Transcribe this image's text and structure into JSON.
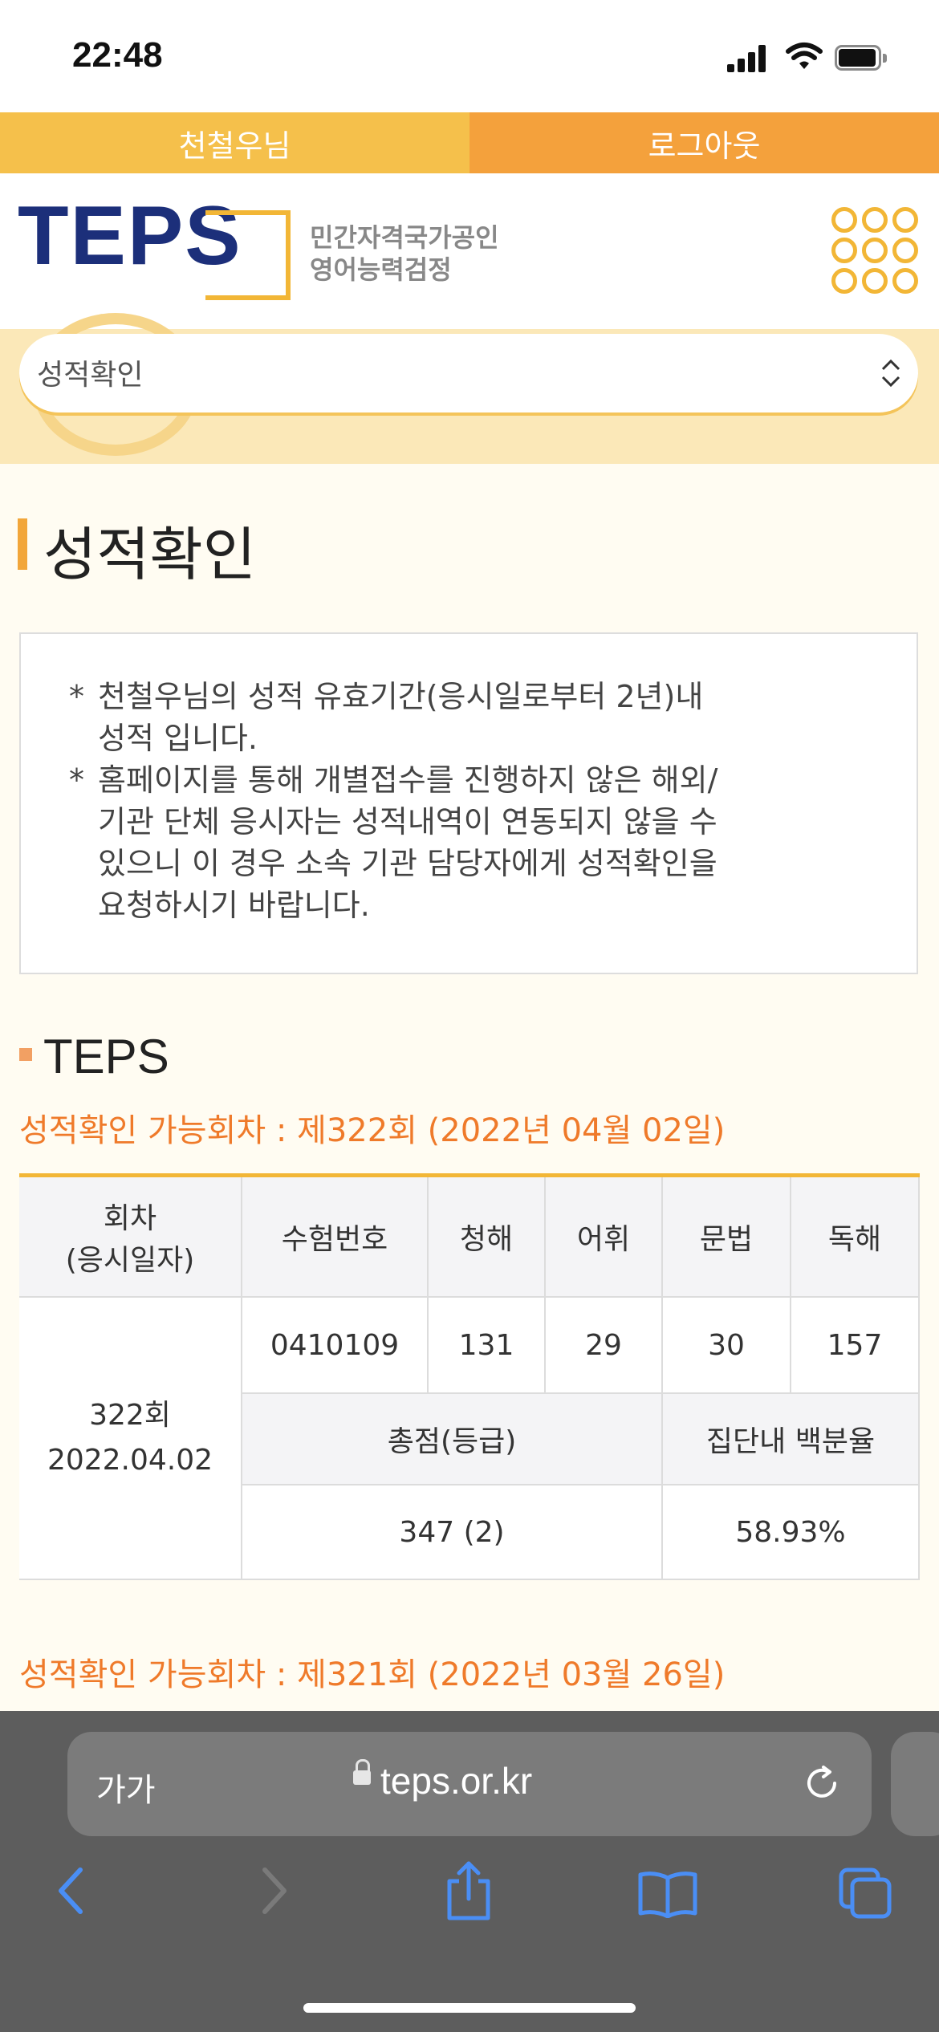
{
  "status_bar": {
    "time": "22:48"
  },
  "top_bar": {
    "user": "천철우님",
    "logout": "로그아웃"
  },
  "header": {
    "logo": "TEPS",
    "subtitle_line1": "민간자격국가공인",
    "subtitle_line2": "영어능력검정"
  },
  "select": {
    "value": "성적확인"
  },
  "page_title": "성적확인",
  "notices": [
    {
      "star": "*",
      "line1": "천철우님의 성적 유효기간(응시일로부터 2년)내",
      "line2": "성적 입니다."
    },
    {
      "star": "*",
      "line1": "홈페이지를 통해 개별접수를 진행하지 않은 해외/",
      "line2": "기관 단체 응시자는 성적내역이 연동되지 않을 수",
      "line3": "있으니 이 경우 소속 기관 담당자에게 성적확인을",
      "line4": "요청하시기 바랍니다."
    }
  ],
  "section": {
    "title": "TEPS"
  },
  "available_1": "성적확인 가능회차 : 제322회 (2022년 04월 02일)",
  "table": {
    "headers": {
      "round_line1": "회차",
      "round_line2": "(응시일자)",
      "exam_no": "수험번호",
      "listening": "청해",
      "vocab": "어휘",
      "grammar": "문법",
      "reading": "독해"
    },
    "row": {
      "round": "322회",
      "date": "2022.04.02",
      "exam_no": "0410109",
      "listening": "131",
      "vocab": "29",
      "grammar": "30",
      "reading": "157"
    },
    "sub_headers": {
      "total": "총점(등급)",
      "percentile": "집단내 백분율"
    },
    "totals": {
      "total": "347 (2)",
      "percentile": "58.93%"
    }
  },
  "available_2": "성적확인 가능회차 : 제321회 (2022년 03월 26일)",
  "browser": {
    "text_size": "가가",
    "url": "teps.or.kr"
  },
  "colors": {
    "yellow": "#f5c04b",
    "orange": "#f4a13c",
    "accent_text": "#ef7a2a",
    "logo_blue": "#1c2f7a"
  }
}
